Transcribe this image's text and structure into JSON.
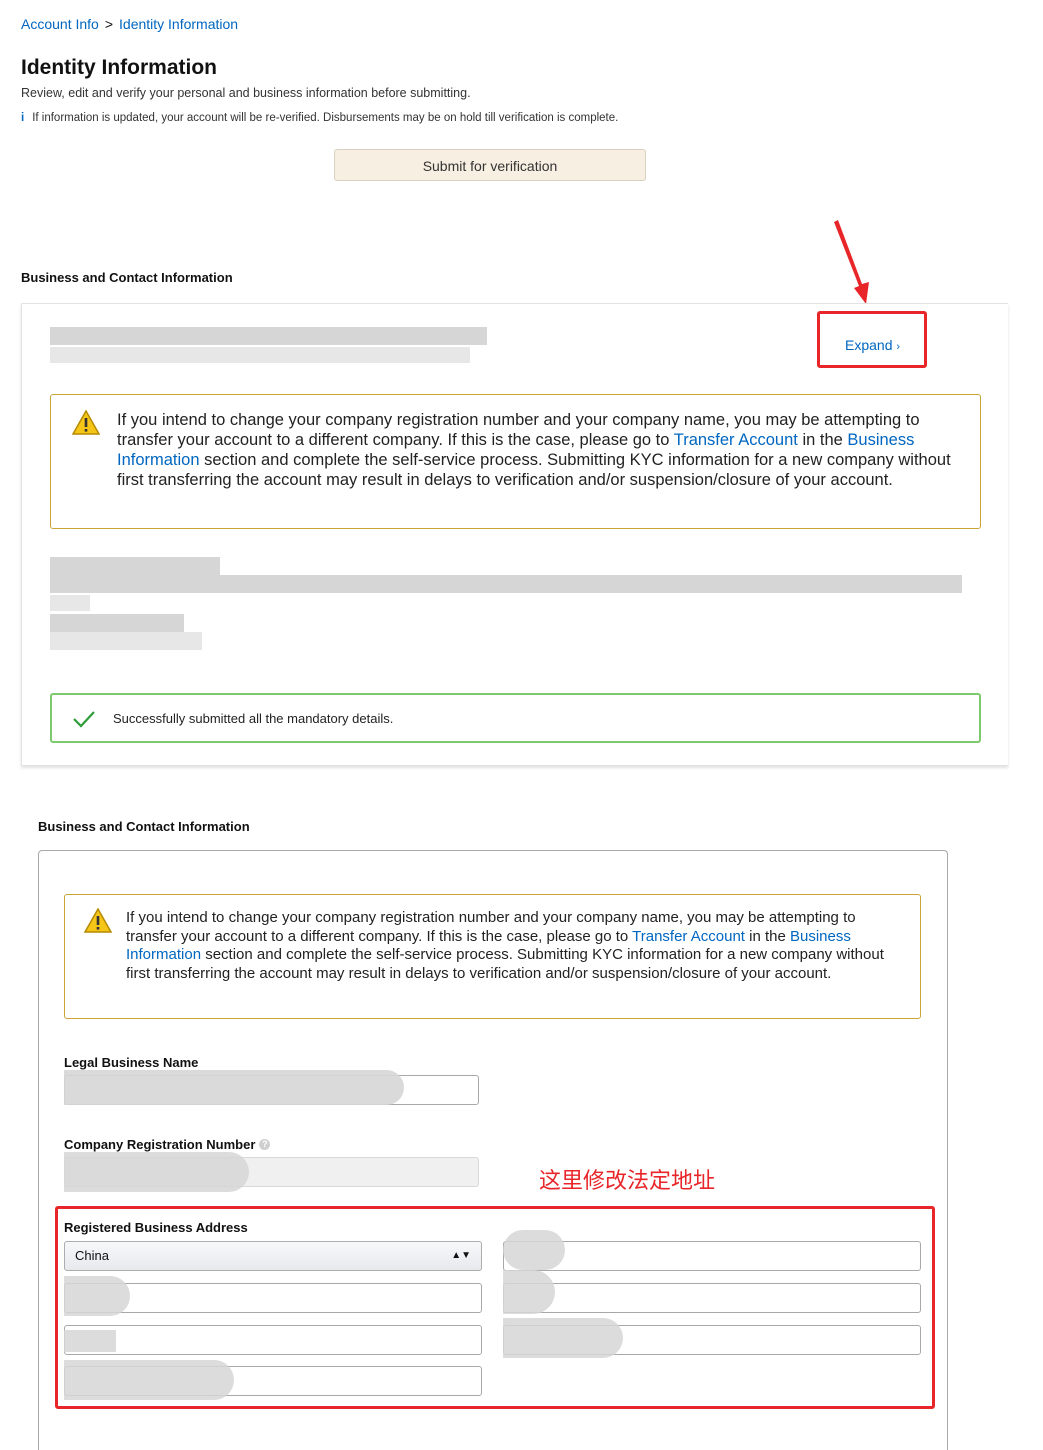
{
  "breadcrumb": {
    "parent": "Account Info",
    "separator": ">",
    "current": "Identity Information"
  },
  "header": {
    "title": "Identity Information",
    "subtitle": "Review, edit and verify your personal and business information before submitting.",
    "info_icon": "i",
    "info_text": "If information is updated, your account will be re-verified. Disbursements may be on hold till verification is complete."
  },
  "submit_button": "Submit for verification",
  "section1": {
    "title": "Business and Contact Information",
    "expand_label": "Expand",
    "expand_chevron": "›",
    "success_text": "Successfully submitted all the mandatory details."
  },
  "warning": {
    "part1": "If you intend to change your company registration number and your company name, you may be attempting to transfer your account to a different company. If this is the case, please go to ",
    "link1": "Transfer Account",
    "part2": " in the ",
    "link2": "Business Information",
    "part3": " section and complete the self-service process. Submitting KYC information for a new company without first transferring the account may result in delays to verification and/or suspension/closure of your account."
  },
  "section2": {
    "title": "Business and Contact Information",
    "legal_name_label": "Legal Business Name",
    "crn_label": "Company Registration Number",
    "address_label": "Registered Business Address",
    "country": "China",
    "annotation": "这里修改法定地址"
  },
  "icons": {
    "warning": "warning-triangle-icon",
    "success": "checkmark-icon",
    "help": "question-circle-icon",
    "arrow": "red-arrow-annotation"
  },
  "colors": {
    "link": "#0066c0",
    "annotation_red": "#e8262a",
    "warning_border": "#c9a43a",
    "success_border": "#7ec86e"
  }
}
